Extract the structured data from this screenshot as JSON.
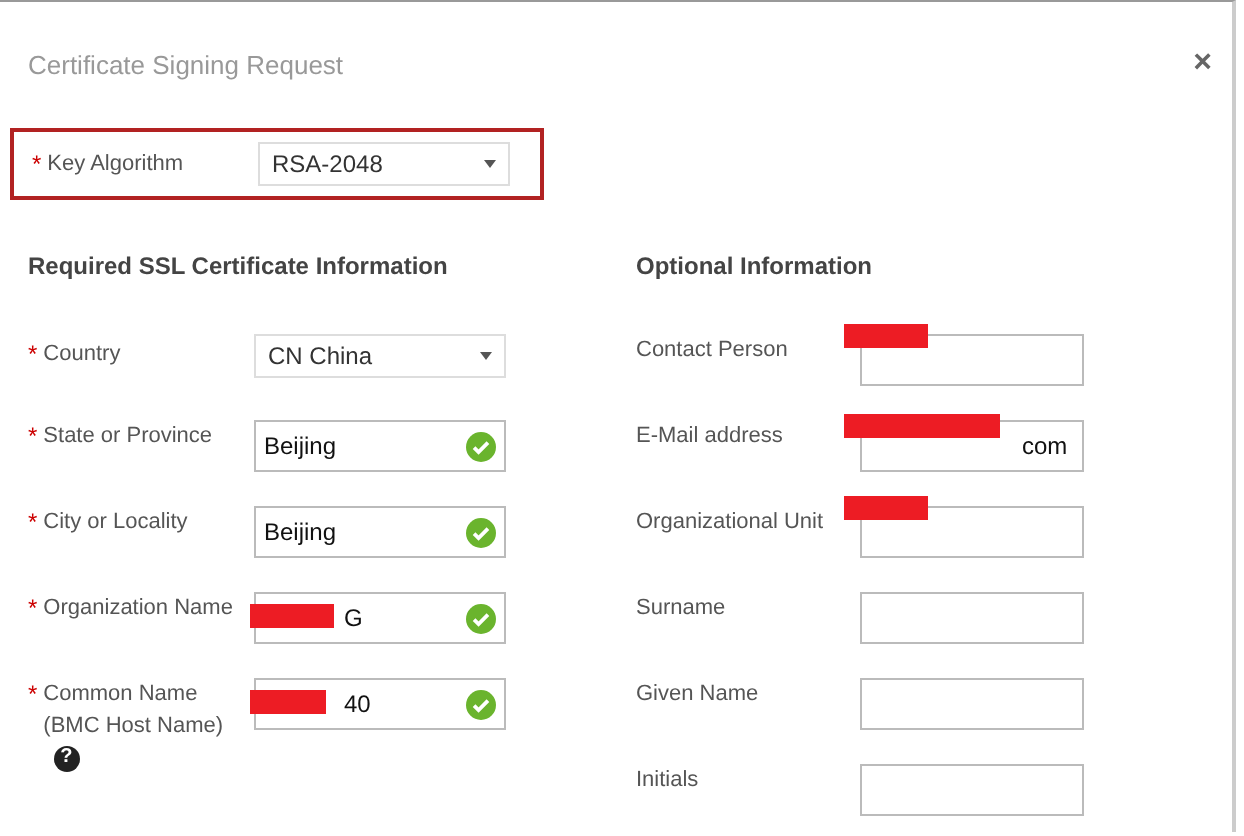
{
  "dialog": {
    "title": "Certificate Signing Request",
    "close": "×"
  },
  "key_algorithm": {
    "marker": "*",
    "label": "Key Algorithm",
    "kind": "select",
    "value": "RSA-2048",
    "highlighted": true
  },
  "required_section": {
    "heading": "Required SSL Certificate Information",
    "fields": [
      {
        "marker": "*",
        "label": "Country",
        "kind": "select",
        "value": "CN China"
      },
      {
        "marker": "*",
        "label": "State or Province",
        "kind": "text",
        "value": "Beijing",
        "valid": true
      },
      {
        "marker": "*",
        "label": "City or Locality",
        "kind": "text",
        "value": "Beijing",
        "valid": true
      },
      {
        "marker": "*",
        "label": "Organization Name",
        "kind": "text",
        "value": "G",
        "valid": true,
        "redacted": true
      },
      {
        "marker": "*",
        "label": "Common Name (BMC Host Name)",
        "kind": "text",
        "value": "40",
        "valid": true,
        "redacted": true,
        "help": "?"
      }
    ]
  },
  "optional_section": {
    "heading": "Optional Information",
    "fields": [
      {
        "label": "Contact Person",
        "kind": "text",
        "redacted": true
      },
      {
        "label": "E-Mail address",
        "kind": "text",
        "value": "com",
        "redacted": true
      },
      {
        "label": "Organizational Unit",
        "kind": "text",
        "redacted": true
      },
      {
        "label": "Surname",
        "kind": "text"
      },
      {
        "label": "Given Name",
        "kind": "text"
      },
      {
        "label": "Initials",
        "kind": "text"
      }
    ]
  }
}
